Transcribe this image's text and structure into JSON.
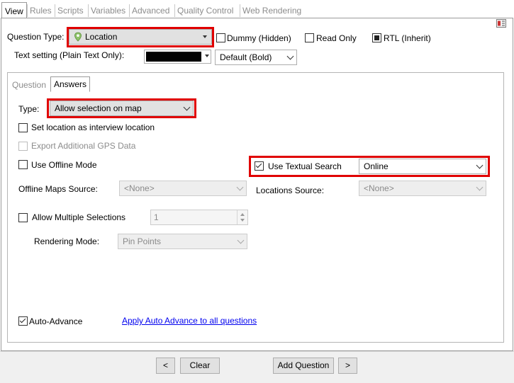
{
  "top_tabs": [
    {
      "label": "View"
    },
    {
      "label": "Rules"
    },
    {
      "label": "Scripts"
    },
    {
      "label": "Variables"
    },
    {
      "label": "Advanced"
    },
    {
      "label": "Quality Control"
    },
    {
      "label": "Web Rendering"
    }
  ],
  "question_type": {
    "label": "Question Type:",
    "value": "Location",
    "icon": "map-pin-icon"
  },
  "flags": {
    "dummy": "Dummy (Hidden)",
    "read_only": "Read Only",
    "rtl": "RTL (Inherit)"
  },
  "text_setting": {
    "label": "Text setting (Plain Text Only):",
    "color_value": "#000000",
    "style_value": "Default (Bold)"
  },
  "inner_tabs": [
    {
      "label": "Question"
    },
    {
      "label": "Answers"
    }
  ],
  "answers": {
    "type_label": "Type:",
    "type_value": "Allow selection on map",
    "set_location": "Set location as interview location",
    "export_gps": "Export Additional GPS Data",
    "offline_mode": "Use Offline Mode",
    "textual_search": "Use Textual Search",
    "textual_search_value": "Online",
    "offline_maps_label": "Offline Maps Source:",
    "offline_maps_value": "<None>",
    "locations_source_label": "Locations Source:",
    "locations_source_value": "<None>",
    "multiple_selections": "Allow Multiple Selections",
    "multiple_value": "1",
    "rendering_label": "Rendering Mode:",
    "rendering_value": "Pin Points",
    "auto_advance": "Auto-Advance",
    "apply_link": "Apply Auto Advance to all questions"
  },
  "bottom": {
    "prev": "<",
    "clear": "Clear",
    "add": "Add Question",
    "next": ">"
  },
  "colors": {
    "highlight": "#e00000",
    "link": "#0000ee",
    "pin": "#6aa84f"
  }
}
